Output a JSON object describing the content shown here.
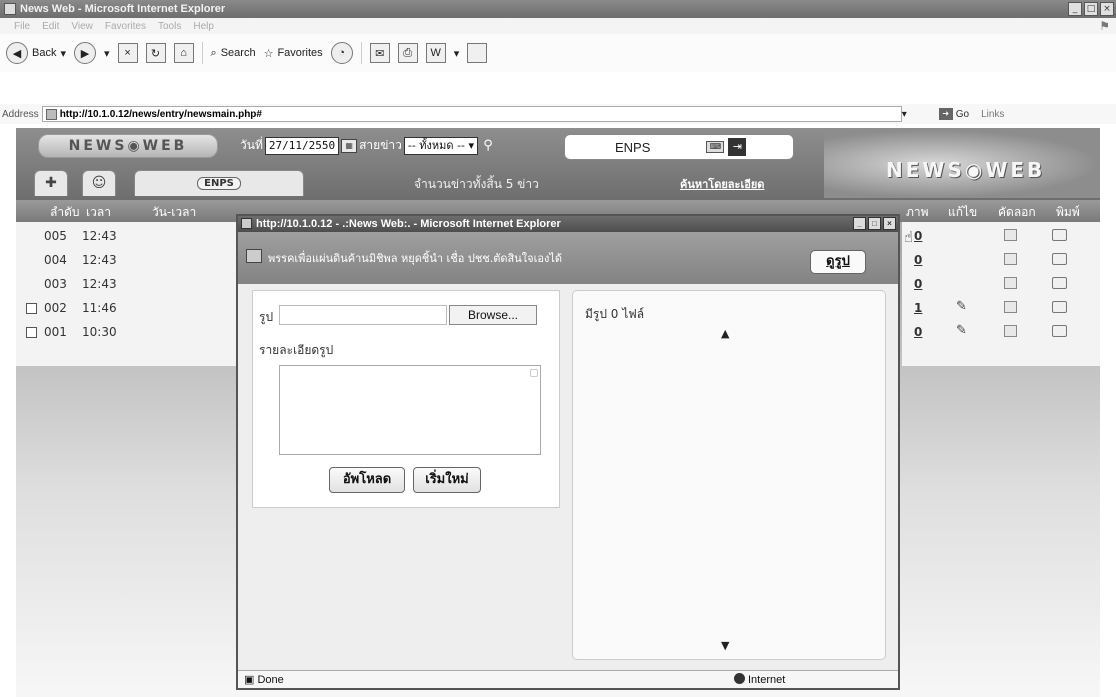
{
  "ie": {
    "window_title": "News Web - Microsoft Internet Explorer",
    "menu": [
      "File",
      "Edit",
      "View",
      "Favorites",
      "Tools",
      "Help"
    ],
    "toolbar": {
      "back": "Back",
      "search": "Search",
      "favorites": "Favorites"
    },
    "address_label": "Address",
    "address_url": "http://10.1.0.12/news/entry/newsmain.php#",
    "go_label": "Go",
    "links_label": "Links"
  },
  "page": {
    "logo_small": "NEWS◉WEB",
    "date_label": "วันที่",
    "date_value": "27/11/2550",
    "news_line_label": "สายข่าว",
    "news_line_value": "-- ทั้งหมด --",
    "enps_label": "ENPS",
    "tab_enps": "ENPS",
    "count_text": "จำนวนข่าวทั้งสิ้น 5 ข่าว",
    "adv_search": "ค้นหาโดยละเอียด",
    "logo_big": "NEWS◉WEB",
    "columns_left": [
      "ลำดับ",
      "เวลา",
      "วัน-เวลา"
    ],
    "columns_right": [
      "ภาพ",
      "แก้ไข",
      "คัดลอก",
      "พิมพ์"
    ],
    "rows": [
      {
        "no": "005",
        "time": "12:43",
        "checkbox": false,
        "pics": "0",
        "editable": false
      },
      {
        "no": "004",
        "time": "12:43",
        "checkbox": false,
        "pics": "0",
        "editable": false
      },
      {
        "no": "003",
        "time": "12:43",
        "checkbox": false,
        "pics": "0",
        "editable": false
      },
      {
        "no": "002",
        "time": "11:46",
        "checkbox": true,
        "pics": "1",
        "editable": true
      },
      {
        "no": "001",
        "time": "10:30",
        "checkbox": true,
        "pics": "0",
        "editable": true
      }
    ]
  },
  "popup": {
    "title": "http://10.1.0.12 - .:News Web:. - Microsoft Internet Explorer",
    "headline": "พรรคเพื่อแผ่นดินค้านมิชิพล หยุดชิ้นำ เชื่อ ปชช.ตัดสินใจเองได้",
    "view_pics_button": "ดูรูป",
    "pic_label": "รูป",
    "browse_button": "Browse...",
    "pic_desc_label": "รายละเอียดรูป",
    "upload_button": "อัพโหลด",
    "reset_button": "เริ่มใหม่",
    "files_count": "มีรูป 0 ไฟล์",
    "status_done": "Done",
    "status_zone": "Internet"
  }
}
